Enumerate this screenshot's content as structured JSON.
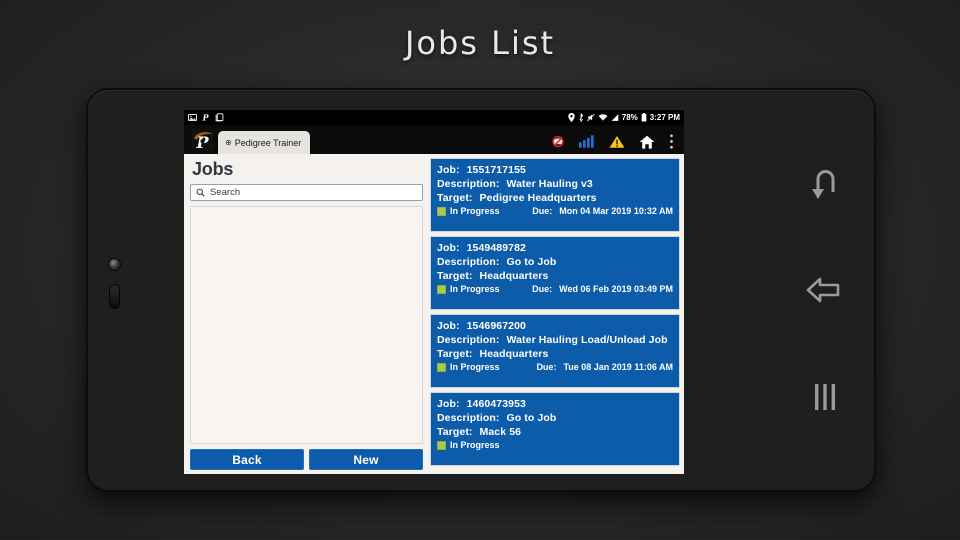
{
  "slide": {
    "title": "Jobs List"
  },
  "statusbar": {
    "left_icons": [
      "image-icon",
      "pedigree-p-icon",
      "copy-icon"
    ],
    "right_icons": [
      "location-pin-icon",
      "bluetooth-icon",
      "mute-icon",
      "wifi-icon",
      "signal-icon"
    ],
    "battery_percent": "78%",
    "battery_icon": "battery-icon",
    "time": "3:27 PM"
  },
  "appbar": {
    "logo": "pedigree-logo-icon",
    "tab_globe": "⊕",
    "tab_label": "Pedigree Trainer",
    "icons": [
      "no-entry-icon",
      "signal-bars-icon",
      "warning-triangle-icon",
      "home-icon",
      "overflow-menu-icon"
    ]
  },
  "left_panel": {
    "title": "Jobs",
    "search": {
      "icon": "search-icon",
      "value": "",
      "placeholder": "Search"
    },
    "buttons": {
      "back": "Back",
      "new": "New"
    }
  },
  "job_cards": [
    {
      "job_label": "Job:",
      "job_value": "1551717155",
      "description_label": "Description:",
      "description_value": "Water Hauling v3",
      "target_label": "Target:",
      "target_value": "Pedigree Headquarters",
      "status": "In Progress",
      "due_label": "Due:",
      "due_value": "Mon 04 Mar 2019 10:32 AM"
    },
    {
      "job_label": "Job:",
      "job_value": "1549489782",
      "description_label": "Description:",
      "description_value": "Go to Job",
      "target_label": "Target:",
      "target_value": "Headquarters",
      "status": "In Progress",
      "due_label": "Due:",
      "due_value": "Wed 06 Feb 2019 03:49 PM"
    },
    {
      "job_label": "Job:",
      "job_value": "1546967200",
      "description_label": "Description:",
      "description_value": "Water Hauling Load/Unload Job",
      "target_label": "Target:",
      "target_value": "Headquarters",
      "status": "In Progress",
      "due_label": "Due:",
      "due_value": "Tue 08 Jan 2019 11:06 AM"
    },
    {
      "job_label": "Job:",
      "job_value": "1460473953",
      "description_label": "Description:",
      "description_value": "Go to Job",
      "target_label": "Target:",
      "target_value": "Mack 56",
      "status": "In Progress",
      "due_label": "",
      "due_value": ""
    }
  ],
  "navbar": {
    "buttons": [
      "back-arrow-icon",
      "recent-apps-icon",
      "menu-bars-icon"
    ]
  },
  "colors": {
    "card_blue": "#0d5caa",
    "status_green": "#a9c953",
    "panel_bg": "#f5f2ee",
    "warning_yellow": "#f5c518",
    "signal_blue": "#1e6fd9"
  }
}
